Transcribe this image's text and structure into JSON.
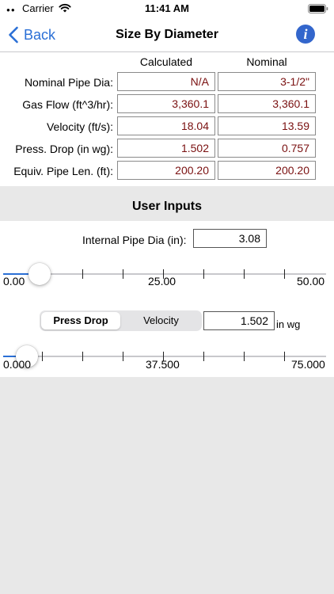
{
  "status_bar": {
    "carrier": "Carrier",
    "time": "11:41 AM"
  },
  "nav": {
    "back_label": "Back",
    "title": "Size By Diameter",
    "info_icon": "i"
  },
  "table": {
    "col_calculated": "Calculated",
    "col_nominal": "Nominal",
    "rows": [
      {
        "label": "Nominal Pipe Dia:",
        "calculated": "N/A",
        "nominal": "3-1/2\""
      },
      {
        "label": "Gas Flow (ft^3/hr):",
        "calculated": "3,360.1",
        "nominal": "3,360.1"
      },
      {
        "label": "Velocity (ft/s):",
        "calculated": "18.04",
        "nominal": "13.59"
      },
      {
        "label": "Press. Drop (in wg):",
        "calculated": "1.502",
        "nominal": "0.757"
      },
      {
        "label": "Equiv. Pipe Len. (ft):",
        "calculated": "200.20",
        "nominal": "200.20"
      }
    ]
  },
  "user_inputs": {
    "section_title": "User Inputs",
    "pipe_dia_label": "Internal Pipe Dia (in):",
    "pipe_dia_value": "3.08",
    "pipe_slider": {
      "min_label": "0.00",
      "mid_label": "25.00",
      "max_label": "50.00",
      "min": 0,
      "max": 50,
      "value": 3.08
    },
    "mode_options": [
      "Press Drop",
      "Velocity"
    ],
    "mode_selected": "Press Drop",
    "press_value": "1.502",
    "press_unit": "in wg",
    "press_slider": {
      "min_label": "0.000",
      "mid_label": "37.500",
      "max_label": "75.000",
      "min": 0,
      "max": 75,
      "value": 1.502
    }
  },
  "colors": {
    "accent": "#2a6fd6",
    "value_text": "#7a1010",
    "info_button": "#3366cc"
  },
  "icons": {
    "back": "chevron-left-icon",
    "info": "info-icon",
    "wifi": "wifi-icon",
    "battery": "battery-icon"
  }
}
